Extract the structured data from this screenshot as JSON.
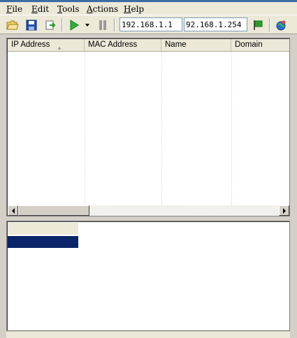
{
  "menu": [
    {
      "accel": "F",
      "rest": "ile"
    },
    {
      "accel": "E",
      "rest": "dit"
    },
    {
      "accel": "T",
      "rest": "ools"
    },
    {
      "accel": "A",
      "rest": "ctions"
    },
    {
      "accel": "H",
      "rest": "elp"
    }
  ],
  "toolbar": {
    "start_ip": "192.168.1.1",
    "end_ip": "92.168.1.254"
  },
  "list": {
    "columns": [
      "IP Address",
      "MAC Address",
      "Name",
      "Domain"
    ],
    "sort_indicator": "▲",
    "rows": []
  },
  "colors": {
    "selection": "#0a246a",
    "chrome": "#ece9d8",
    "window": "#d4d0c8"
  },
  "icons": [
    "open-folder-icon",
    "save-icon",
    "export-icon",
    "play-icon",
    "dropdown-arrow-icon",
    "pause-icon",
    "flag-icon",
    "globe-icon"
  ]
}
